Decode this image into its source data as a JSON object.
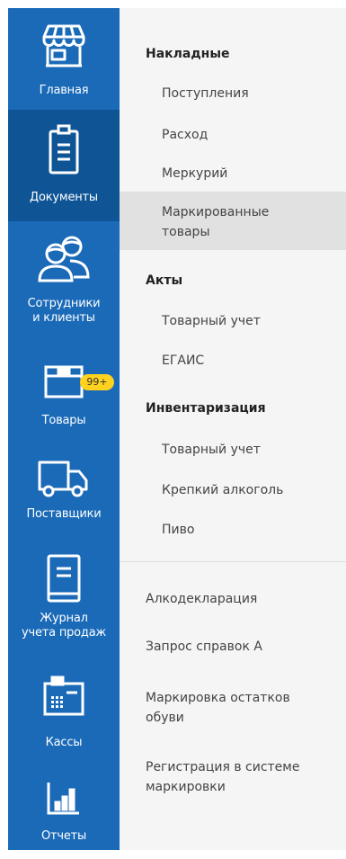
{
  "rail": {
    "items": [
      {
        "label": "Главная",
        "icon": "storefront-icon"
      },
      {
        "label": "Документы",
        "icon": "clipboard-icon"
      },
      {
        "label": "Сотрудники\nи клиенты",
        "icon": "people-icon"
      },
      {
        "label": "Товары",
        "icon": "box-icon",
        "badge": "99+"
      },
      {
        "label": "Поставщики",
        "icon": "truck-icon"
      },
      {
        "label": "Журнал\nучета продаж",
        "icon": "journal-icon"
      },
      {
        "label": "Кассы",
        "icon": "cash-register-icon"
      },
      {
        "label": "Отчеты",
        "icon": "bar-chart-icon"
      }
    ],
    "active_index": 1
  },
  "menu": {
    "sections": [
      {
        "title": "Накладные",
        "items": [
          "Поступления",
          "Расход",
          "Меркурий",
          "Маркированные\nтовары"
        ]
      },
      {
        "title": "Акты",
        "items": [
          "Товарный учет",
          "ЕГАИС"
        ]
      },
      {
        "title": "Инвентаризация",
        "items": [
          "Товарный учет",
          "Крепкий алкоголь",
          "Пиво"
        ]
      }
    ],
    "highlighted_item": "Маркированные\nтовары",
    "bottom_links": [
      "Алкодекларация",
      "Запрос справок А",
      "Маркировка остатков\nобуви",
      "Регистрация в системе\nмаркировки"
    ]
  },
  "colors": {
    "rail": "#1a6ab8",
    "rail_active": "#0f5596",
    "badge": "#ffd21f",
    "panel": "#f5f5f5",
    "highlight": "#e1e1e1"
  }
}
